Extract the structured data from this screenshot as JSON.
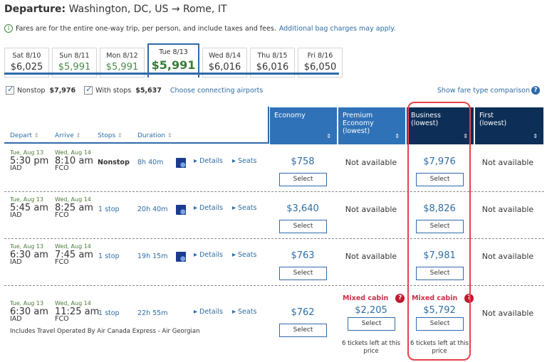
{
  "header": {
    "label": "Departure:",
    "route": "Washington, DC, US → Rome, IT"
  },
  "notice": {
    "icon": "info-icon",
    "text": "Fares are for the entire one-way trip, per person, and include taxes and fees.",
    "link": "Additional bag charges may apply."
  },
  "dates": [
    {
      "day": "Sat 8/10",
      "price": "$6,025"
    },
    {
      "day": "Sun 8/11",
      "price": "$5,991"
    },
    {
      "day": "Mon 8/12",
      "price": "$5,991"
    },
    {
      "day": "Tue 8/13",
      "price": "$5,991",
      "selected": true
    },
    {
      "day": "Wed 8/14",
      "price": "$6,016"
    },
    {
      "day": "Thu 8/15",
      "price": "$6,016"
    },
    {
      "day": "Fri 8/16",
      "price": "$6,050"
    }
  ],
  "filters": {
    "nonstop_label": "Nonstop",
    "nonstop_price": "$7,976",
    "nonstop_checked": true,
    "withstops_label": "With stops",
    "withstops_price": "$5,637",
    "withstops_checked": true,
    "connecting_link": "Choose connecting airports",
    "compare_link": "Show fare type comparison"
  },
  "columns": {
    "depart": "Depart",
    "arrive": "Arrive",
    "stops": "Stops",
    "duration": "Duration",
    "sort_glyph": "⇕",
    "economy": "Economy",
    "premium_1": "Premium",
    "premium_2": "Economy",
    "premium_3": "(lowest)",
    "business_1": "Business",
    "business_2": "(lowest)",
    "first_1": "First",
    "first_2": "(lowest)"
  },
  "labels": {
    "select": "Select",
    "details": "Details",
    "seats": "Seats",
    "not_available": "Not available",
    "mixed_cabin": "Mixed cabin",
    "tickets_left_1": "6 tickets left at this",
    "tickets_left_2": "price",
    "qmark": "?"
  },
  "flights": [
    {
      "depart_date": "Tue, Aug 13",
      "depart_time": "5:30 pm",
      "depart_airport": "IAD",
      "arrive_date": "Wed, Aug 14",
      "arrive_time": "8:10 am",
      "arrive_airport": "FCO",
      "stops": "Nonstop",
      "duration": "8h 40m",
      "economy": "$758",
      "premium": "Not available",
      "business": "$7,976",
      "first": "Not available"
    },
    {
      "depart_date": "Tue, Aug 13",
      "depart_time": "5:45 am",
      "depart_airport": "IAD",
      "arrive_date": "Wed, Aug 14",
      "arrive_time": "8:25 am",
      "arrive_airport": "FCO",
      "stops": "1 stop",
      "duration": "20h 40m",
      "economy": "$3,640",
      "premium": "Not available",
      "business": "$8,826",
      "first": "Not available"
    },
    {
      "depart_date": "Tue, Aug 13",
      "depart_time": "6:30 am",
      "depart_airport": "IAD",
      "arrive_date": "Wed, Aug 14",
      "arrive_time": "7:45 am",
      "arrive_airport": "FCO",
      "stops": "1 stop",
      "duration": "19h 15m",
      "economy": "$763",
      "premium": "Not available",
      "business": "$7,981",
      "first": "Not available"
    },
    {
      "depart_date": "Tue, Aug 13",
      "depart_time": "6:30 am",
      "depart_airport": "IAD",
      "arrive_date": "Wed, Aug 14",
      "arrive_time": "11:25 am",
      "arrive_airport": "FCO",
      "stops": "1 stop",
      "duration": "22h 55m",
      "economy": "$762",
      "premium": "$2,205",
      "business": "$5,792",
      "first": "Not available",
      "operated_by": "Includes Travel Operated By Air Canada Express - Air Georgian"
    }
  ],
  "colors": {
    "accent_blue": "#2f6aa8",
    "economy_header": "#2f72b8",
    "dark_header": "#0c2e57",
    "mixed_red": "#c7314a",
    "highlight_red": "#e8414a",
    "green_price": "#3a7a3a"
  }
}
